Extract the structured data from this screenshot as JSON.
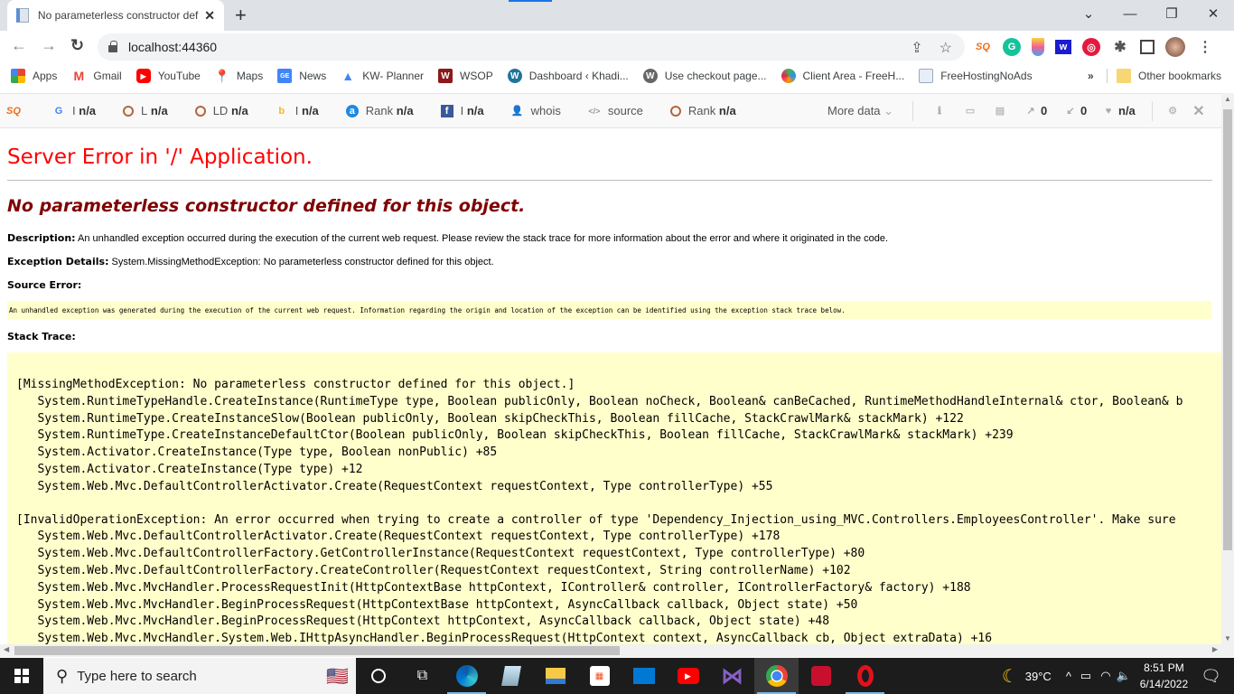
{
  "browser": {
    "tab_title": "No parameterless constructor defined for this object.",
    "tab_title_visible": "No parameterless constructor de",
    "new_tab_label": "+",
    "url": "localhost:44360",
    "window_controls": {
      "dropdown": "⌄",
      "minimize": "—",
      "restore": "❐",
      "close": "✕"
    }
  },
  "bookmarks": [
    {
      "label": "Apps",
      "icon": "apps-grid-icon"
    },
    {
      "label": "Gmail",
      "icon": "gmail-icon"
    },
    {
      "label": "YouTube",
      "icon": "youtube-icon"
    },
    {
      "label": "Maps",
      "icon": "maps-icon"
    },
    {
      "label": "News",
      "icon": "news-icon"
    },
    {
      "label": "KW- Planner",
      "icon": "google-ads-icon"
    },
    {
      "label": "WSOP",
      "icon": "wsop-icon"
    },
    {
      "label": "Dashboard ‹ Khadi...",
      "icon": "wordpress-icon"
    },
    {
      "label": "Use checkout page...",
      "icon": "wordpress-icon"
    },
    {
      "label": "Client Area - FreeH...",
      "icon": "client-area-icon"
    },
    {
      "label": "FreeHostingNoAds",
      "icon": "freehosting-icon"
    }
  ],
  "bookmarks_overflow": "»",
  "other_bookmarks": "Other bookmarks",
  "seoquake": {
    "items": [
      {
        "prefix": "I",
        "value": "n/a",
        "icon": "google-icon"
      },
      {
        "prefix": "L",
        "value": "n/a",
        "icon": "semrush-ring-icon"
      },
      {
        "prefix": "LD",
        "value": "n/a",
        "icon": "semrush-ring-icon"
      },
      {
        "prefix": "I",
        "value": "n/a",
        "icon": "bing-icon"
      },
      {
        "prefix": "Rank",
        "value": "n/a",
        "icon": "alexa-icon"
      },
      {
        "prefix": "I",
        "value": "n/a",
        "icon": "facebook-icon"
      },
      {
        "prefix": "whois",
        "value": "",
        "icon": "user-icon"
      },
      {
        "prefix": "source",
        "value": "",
        "icon": "code-icon"
      },
      {
        "prefix": "Rank",
        "value": "n/a",
        "icon": "semrush-ring-icon"
      }
    ],
    "more_data": "More data",
    "external_links": "0",
    "internal_links": "0",
    "health": "n/a"
  },
  "page": {
    "server_error_title": "Server Error in '/' Application.",
    "error_message": "No parameterless constructor defined for this object.",
    "description_label": "Description:",
    "description_text": "An unhandled exception occurred during the execution of the current web request. Please review the stack trace for more information about the error and where it originated in the code.",
    "exception_label": "Exception Details:",
    "exception_text": "System.MissingMethodException: No parameterless constructor defined for this object.",
    "source_error_label": "Source Error:",
    "source_error_text": "An unhandled exception was generated during the execution of the current web request. Information regarding the origin and location of the exception can be identified using the exception stack trace below.",
    "stack_trace_label": "Stack Trace:",
    "stack_block_1": [
      "[MissingMethodException: No parameterless constructor defined for this object.]",
      "   System.RuntimeTypeHandle.CreateInstance(RuntimeType type, Boolean publicOnly, Boolean noCheck, Boolean& canBeCached, RuntimeMethodHandleInternal& ctor, Boolean& b",
      "   System.RuntimeType.CreateInstanceSlow(Boolean publicOnly, Boolean skipCheckThis, Boolean fillCache, StackCrawlMark& stackMark) +122",
      "   System.RuntimeType.CreateInstanceDefaultCtor(Boolean publicOnly, Boolean skipCheckThis, Boolean fillCache, StackCrawlMark& stackMark) +239",
      "   System.Activator.CreateInstance(Type type, Boolean nonPublic) +85",
      "   System.Activator.CreateInstance(Type type) +12",
      "   System.Web.Mvc.DefaultControllerActivator.Create(RequestContext requestContext, Type controllerType) +55"
    ],
    "stack_block_2": [
      "[InvalidOperationException: An error occurred when trying to create a controller of type 'Dependency_Injection_using_MVC.Controllers.EmployeesController'. Make sure",
      "   System.Web.Mvc.DefaultControllerActivator.Create(RequestContext requestContext, Type controllerType) +178",
      "   System.Web.Mvc.DefaultControllerFactory.GetControllerInstance(RequestContext requestContext, Type controllerType) +80",
      "   System.Web.Mvc.DefaultControllerFactory.CreateController(RequestContext requestContext, String controllerName) +102",
      "   System.Web.Mvc.MvcHandler.ProcessRequestInit(HttpContextBase httpContext, IController& controller, IControllerFactory& factory) +188",
      "   System.Web.Mvc.MvcHandler.BeginProcessRequest(HttpContextBase httpContext, AsyncCallback callback, Object state) +50",
      "   System.Web.Mvc.MvcHandler.BeginProcessRequest(HttpContext httpContext, AsyncCallback callback, Object state) +48",
      "   System.Web.Mvc.MvcHandler.System.Web.IHttpAsyncHandler.BeginProcessRequest(HttpContext context, AsyncCallback cb, Object extraData) +16"
    ]
  },
  "taskbar": {
    "search_placeholder": "Type here to search",
    "apps": [
      "cortana-icon",
      "task-view-icon",
      "edge-icon",
      "notepad-icon",
      "file-explorer-icon",
      "store-icon",
      "mail-icon",
      "youtube-icon",
      "visual-studio-icon",
      "chrome-icon",
      "screen-recorder-icon",
      "opera-icon"
    ],
    "weather": "39°C",
    "time": "8:51 PM",
    "date": "6/14/2022"
  },
  "colors": {
    "error_title": "#ff0000",
    "error_message": "#800000",
    "code_background": "#ffffcc"
  }
}
